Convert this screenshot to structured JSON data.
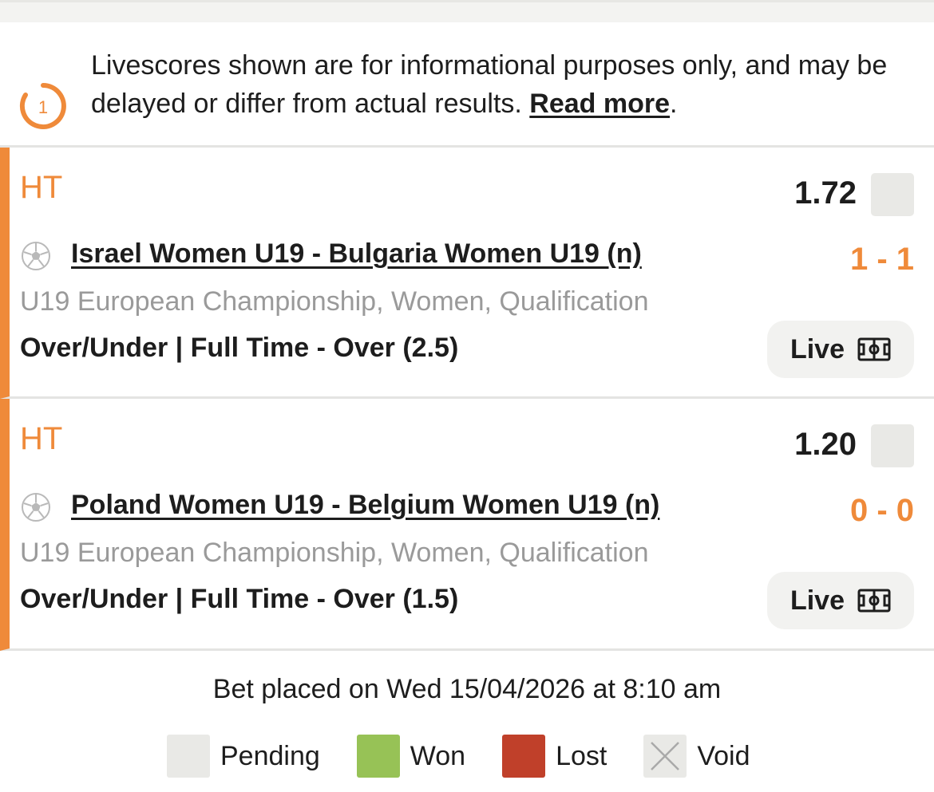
{
  "notice": {
    "icon_number": "1",
    "text": "Livescores shown are for informational purposes only, and may be delayed or differ from actual results. ",
    "link": "Read more",
    "suffix": "."
  },
  "bets": [
    {
      "status": "HT",
      "odds": "1.72",
      "match": "Israel Women U19 - Bulgaria Women U19 (n)",
      "score": "1 - 1",
      "league": "U19 European Championship, Women, Qualification",
      "market": "Over/Under | Full Time - Over (2.5)",
      "live_label": "Live"
    },
    {
      "status": "HT",
      "odds": "1.20",
      "match": "Poland Women U19 - Belgium Women U19 (n)",
      "score": "0 - 0",
      "league": "U19 European Championship, Women, Qualification",
      "market": "Over/Under | Full Time - Over (1.5)",
      "live_label": "Live"
    }
  ],
  "placed": "Bet placed on Wed 15/04/2026 at 8:10 am",
  "legend": [
    {
      "label": "Pending",
      "color": "#e9e9e6"
    },
    {
      "label": "Won",
      "color": "#97c256"
    },
    {
      "label": "Lost",
      "color": "#c0402a"
    },
    {
      "label": "Void",
      "color": "#e9e9e6"
    }
  ],
  "colors": {
    "accent": "#ef8a3a",
    "muted_text": "#9a9a9a",
    "pending_box": "#e9e9e6"
  },
  "icons": {
    "notice": "countdown-circle-icon",
    "sport": "soccer-ball-icon",
    "live": "football-pitch-icon",
    "void": "cross-icon"
  }
}
